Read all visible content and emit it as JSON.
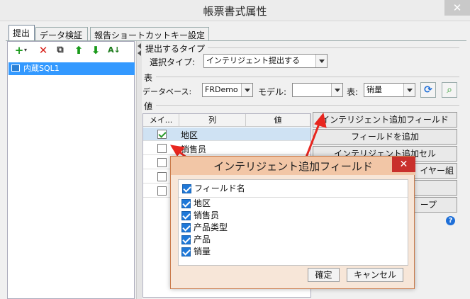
{
  "window": {
    "title": "帳票書式属性",
    "close_glyph": "✕"
  },
  "tabs": [
    {
      "label": "提出"
    },
    {
      "label": "データ検証"
    },
    {
      "label": "報告ショートカットキー設定"
    }
  ],
  "datasource": {
    "item": "内蔵SQL1"
  },
  "submit_type": {
    "group_label": "提出するタイプ",
    "select_label": "選択タイプ:",
    "select_value": "インテリジェント提出する"
  },
  "table_section": {
    "group_label": "表",
    "datasource_label": "データベース:",
    "datasource_value": "FRDemo",
    "model_label": "モデル:",
    "model_value": "",
    "table_label": "表:",
    "table_value": "销量"
  },
  "value_section": {
    "group_label": "値",
    "columns": [
      "メイ...",
      "列",
      "値"
    ],
    "rows": [
      {
        "checked": true,
        "column": "地区",
        "value": ""
      },
      {
        "checked": false,
        "column": "销售员",
        "value": ""
      },
      {
        "checked": false,
        "column": "",
        "value": ""
      },
      {
        "checked": false,
        "column": "",
        "value": ""
      },
      {
        "checked": false,
        "column": "",
        "value": ""
      }
    ]
  },
  "side_buttons": {
    "intelligent_add_field": "インテリジェント追加フィールド",
    "add_field": "フィールドを追加",
    "intelligent_add_cell": "インテリジェント追加セル",
    "layer_group_tail": "イヤー組",
    "group_tail": "ープ"
  },
  "modal": {
    "title": "インテリジェント追加フィールド",
    "close_glyph": "✕",
    "header_item": "フィールド名",
    "items": [
      "地区",
      "销售员",
      "产品类型",
      "产品",
      "销量"
    ],
    "ok_label": "確定",
    "cancel_label": "キャンセル"
  },
  "help": {
    "glyph": "?"
  },
  "colors": {
    "accent": "#1e78d8",
    "arrow": "#e8261f",
    "selection": "#3399ff",
    "modal_bg": "#f7e6d8"
  },
  "icons": [
    "add-icon",
    "delete-icon",
    "copy-icon",
    "move-up-icon",
    "move-down-icon",
    "sort-icon",
    "refresh-icon",
    "preview-icon",
    "help-icon"
  ]
}
